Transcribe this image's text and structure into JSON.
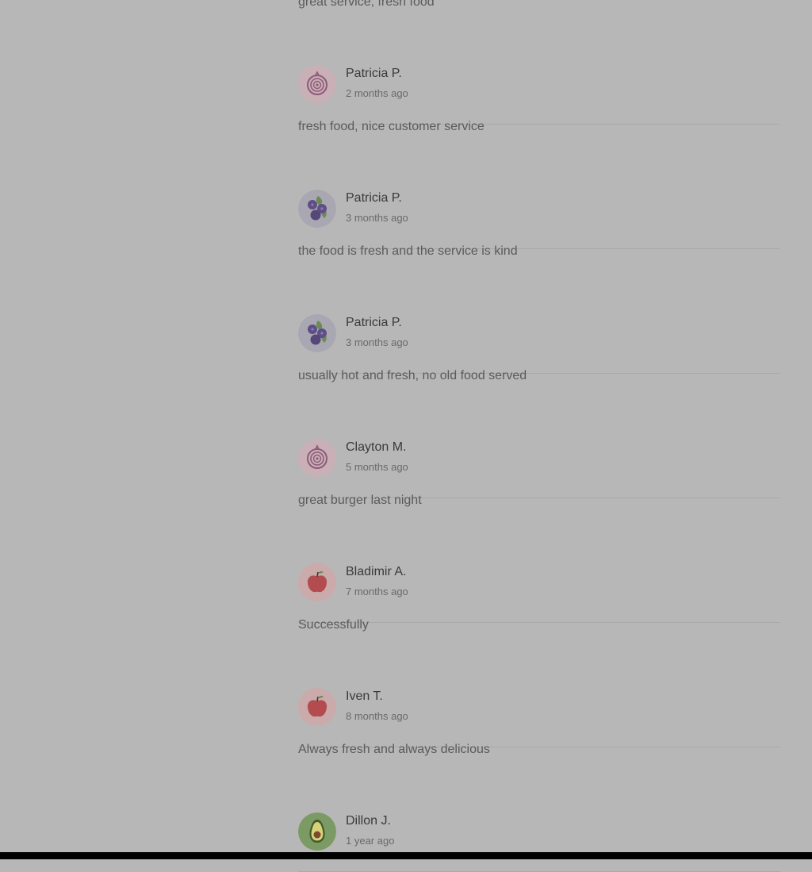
{
  "reviews": [
    {
      "name": "",
      "time": "",
      "text": "great service, fresh food",
      "avatar": "onion-icon"
    },
    {
      "name": "Patricia P.",
      "time": "2 months ago",
      "text": "fresh food, nice customer service",
      "avatar": "onion-icon"
    },
    {
      "name": "Patricia P.",
      "time": "3 months ago",
      "text": "the food is fresh and the service is kind",
      "avatar": "blueberries-icon"
    },
    {
      "name": "Patricia P.",
      "time": "3 months ago",
      "text": "usually hot and fresh, no old food served",
      "avatar": "blueberries-icon"
    },
    {
      "name": "Clayton M.",
      "time": "5 months ago",
      "text": "great burger last night",
      "avatar": "onion-icon"
    },
    {
      "name": "Bladimir A.",
      "time": "7 months ago",
      "text": "Successfully",
      "avatar": "apple-icon"
    },
    {
      "name": "Iven T.",
      "time": "8 months ago",
      "text": "Always fresh and always delicious",
      "avatar": "apple-icon"
    },
    {
      "name": "Dillon J.",
      "time": "1 year ago",
      "text": "",
      "avatar": "avocado-icon"
    }
  ],
  "colors": {
    "background": "#b7b7b7",
    "divider": "#a9a9a9",
    "onion_bg": "#c9afb6",
    "berries_bg": "#a9a7b2",
    "apple_bg": "#cbaaab",
    "avocado_bg": "#7c9a64"
  }
}
